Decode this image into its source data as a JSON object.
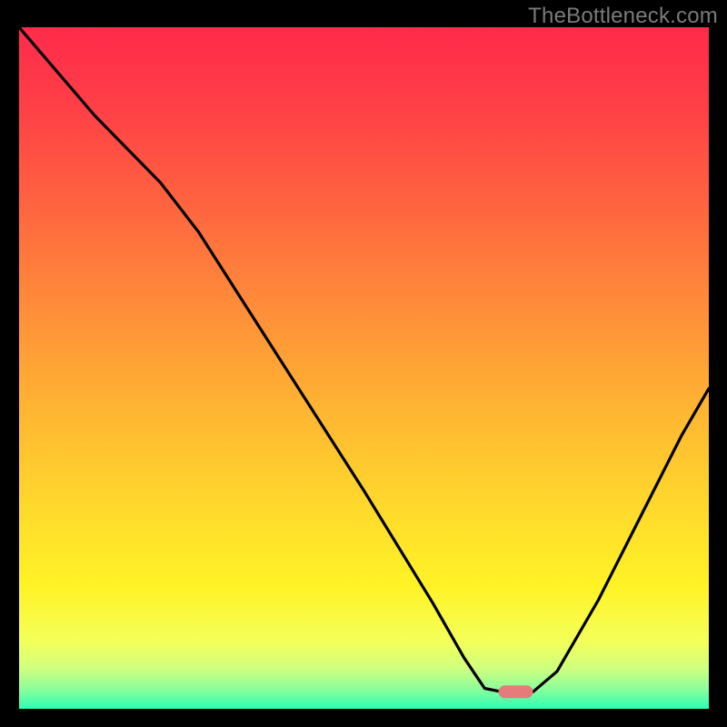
{
  "watermark": "TheBottleneck.com",
  "gradient": {
    "stops": [
      {
        "offset": 0.0,
        "color": "#ff2a4b"
      },
      {
        "offset": 0.12,
        "color": "#ff4046"
      },
      {
        "offset": 0.25,
        "color": "#ff6140"
      },
      {
        "offset": 0.4,
        "color": "#ff8a3a"
      },
      {
        "offset": 0.55,
        "color": "#ffb233"
      },
      {
        "offset": 0.7,
        "color": "#ffd82c"
      },
      {
        "offset": 0.82,
        "color": "#fff326"
      },
      {
        "offset": 0.9,
        "color": "#f4ff58"
      },
      {
        "offset": 0.94,
        "color": "#d1ff7e"
      },
      {
        "offset": 0.97,
        "color": "#8eff9a"
      },
      {
        "offset": 1.0,
        "color": "#2dffb3"
      }
    ]
  },
  "marker": {
    "color": "#e77a7a",
    "x1": 0.695,
    "x2": 0.745,
    "y": 0.975,
    "thickness_px": 14,
    "radius_px": 7
  },
  "chart_data": {
    "type": "line",
    "title": "",
    "xlabel": "",
    "ylabel": "",
    "xlim": [
      0,
      1
    ],
    "ylim": [
      0,
      1
    ],
    "note": "Axes are normalized (no tick labels shown). y increases downward in image; values below are conventional y-up (0 at bottom).",
    "series": [
      {
        "name": "curve",
        "points": [
          {
            "x": 0.0,
            "y": 1.0
          },
          {
            "x": 0.11,
            "y": 0.87
          },
          {
            "x": 0.205,
            "y": 0.772
          },
          {
            "x": 0.26,
            "y": 0.7
          },
          {
            "x": 0.38,
            "y": 0.51
          },
          {
            "x": 0.5,
            "y": 0.32
          },
          {
            "x": 0.6,
            "y": 0.155
          },
          {
            "x": 0.645,
            "y": 0.075
          },
          {
            "x": 0.675,
            "y": 0.03
          },
          {
            "x": 0.7,
            "y": 0.025
          },
          {
            "x": 0.745,
            "y": 0.025
          },
          {
            "x": 0.78,
            "y": 0.055
          },
          {
            "x": 0.84,
            "y": 0.16
          },
          {
            "x": 0.9,
            "y": 0.28
          },
          {
            "x": 0.96,
            "y": 0.4
          },
          {
            "x": 1.0,
            "y": 0.47
          }
        ]
      }
    ]
  }
}
